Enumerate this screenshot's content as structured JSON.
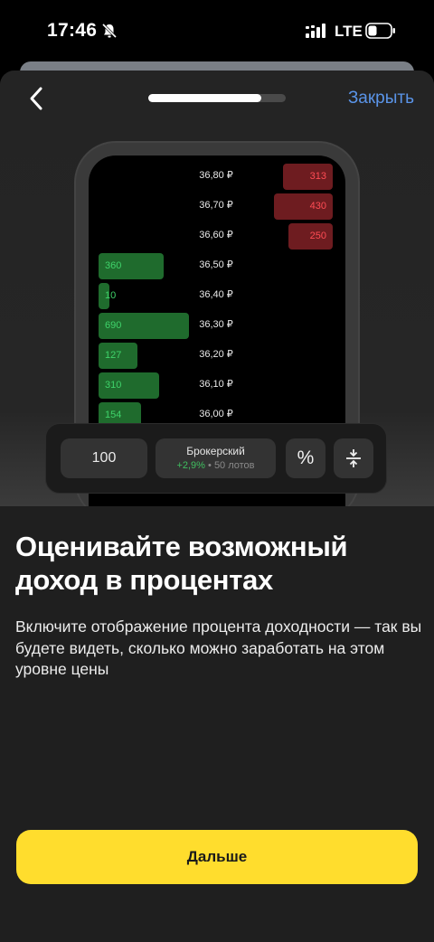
{
  "status_bar": {
    "time": "17:46",
    "network": "LTE",
    "icons": [
      "bell-slash-icon",
      "signal-icon",
      "battery-icon"
    ]
  },
  "nav": {
    "back_icon": "chevron-left-icon",
    "progress": 0.82,
    "close_label": "Закрыть"
  },
  "order_book": {
    "rows": [
      {
        "price": "36,80 ₽",
        "side": "ask",
        "volume": "313"
      },
      {
        "price": "36,70 ₽",
        "side": "ask",
        "volume": "430"
      },
      {
        "price": "36,60 ₽",
        "side": "ask",
        "volume": "250"
      },
      {
        "price": "36,50 ₽",
        "side": "bid",
        "volume": "360"
      },
      {
        "price": "36,40 ₽",
        "side": "bid",
        "volume": "10"
      },
      {
        "price": "36,30 ₽",
        "side": "bid",
        "volume": "690"
      },
      {
        "price": "36,20 ₽",
        "side": "bid",
        "volume": "127"
      },
      {
        "price": "36,10 ₽",
        "side": "bid",
        "volume": "310"
      },
      {
        "price": "36,00 ₽",
        "side": "bid",
        "volume": "154"
      }
    ]
  },
  "toolbar": {
    "quantity": "100",
    "account_name": "Брокерский",
    "account_change": "+2,9%",
    "separator": "•",
    "account_lots": "50 лотов",
    "percent_label": "%",
    "collapse_icon": "collapse-vertical-icon"
  },
  "content": {
    "headline": "Оценивайте возможный доход в процентах",
    "description": "Включите отображение процента доходности — так вы будете видеть, сколько можно заработать на этом уровне цены"
  },
  "footer": {
    "next_label": "Дальше"
  },
  "colors": {
    "accent_yellow": "#FFDD2D",
    "link_blue": "#5A94E8",
    "bid_bar": "#1F6B2D",
    "bid_text": "#3FD36A",
    "ask_bar": "#6E1C20",
    "ask_text": "#FF4C54"
  }
}
